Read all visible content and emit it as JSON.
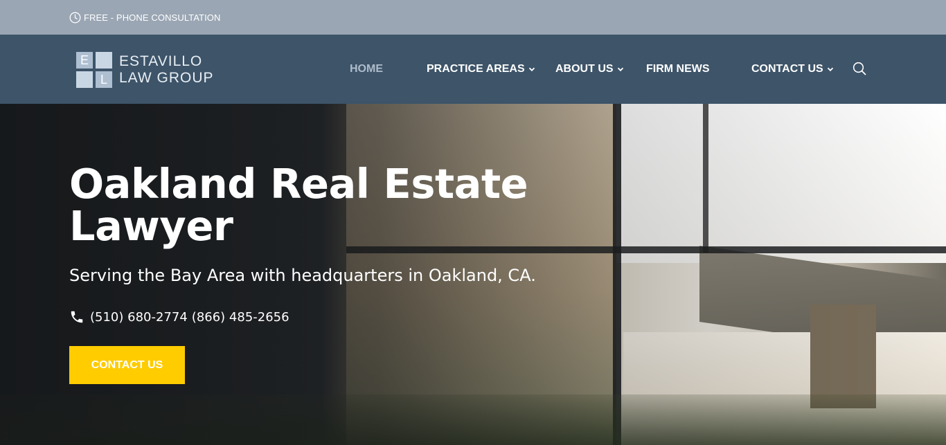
{
  "topbar": {
    "icon": "clock-icon",
    "text": "FREE - PHONE CONSULTATION"
  },
  "logo": {
    "letters": [
      "E",
      "",
      "",
      "L"
    ],
    "line1": "ESTAVILLO",
    "line2": "LAW GROUP"
  },
  "nav": {
    "items": [
      {
        "label": "HOME",
        "active": true
      },
      {
        "label": "PRACTICE AREAS",
        "dropdown": true
      },
      {
        "label": "ABOUT US",
        "dropdown": true
      },
      {
        "label": "FIRM NEWS"
      },
      {
        "label": "CONTACT US",
        "dropdown": true
      }
    ],
    "search_icon": "search-icon"
  },
  "hero": {
    "title": "Oakland Real Estate Lawyer",
    "subtitle": "Serving the Bay Area with headquarters in Oakland, CA.",
    "phone_icon": "phone-icon",
    "phone1": "(510) 680-2774",
    "phone2": "(866) 485-2656",
    "cta_label": "CONTACT US"
  },
  "colors": {
    "topbar_bg": "#9aa6b4",
    "nav_bg": "#3d5469",
    "nav_active": "#aebccb",
    "cta_bg": "#ffcc00",
    "text": "#ffffff"
  }
}
